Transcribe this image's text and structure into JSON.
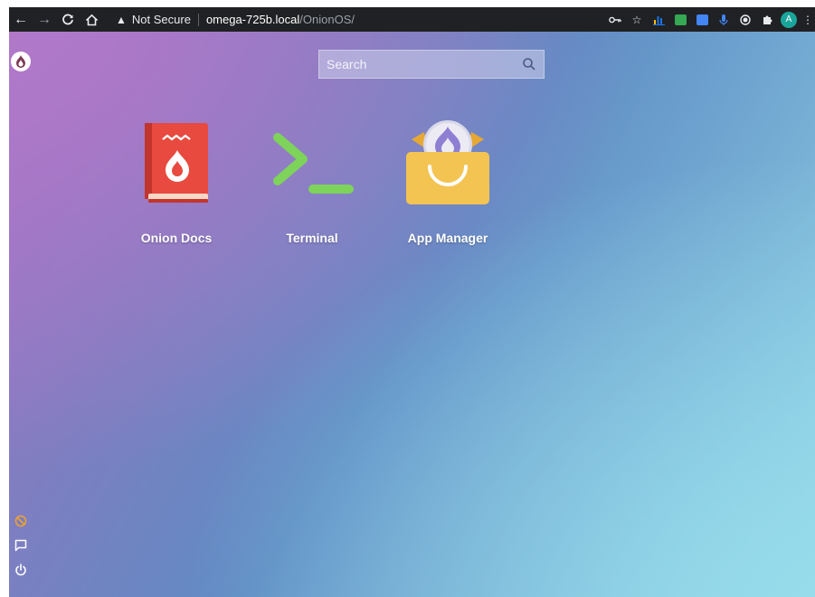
{
  "browser": {
    "security_label": "Not Secure",
    "url_host": "omega-725b.local",
    "url_path": "/OnionOS/",
    "avatar_letter": "A",
    "extensions": [
      {
        "icon": "bar-chart-icon",
        "color": "#1a73e8"
      },
      {
        "icon": "green-box-icon",
        "color": "#34a853"
      },
      {
        "icon": "translate-icon",
        "color": "#4285f4"
      },
      {
        "icon": "microphone-icon",
        "color": "#4285f4"
      },
      {
        "icon": "record-icon",
        "color": "#e8eaed"
      },
      {
        "icon": "puzzle-icon",
        "color": "#e8eaed"
      }
    ]
  },
  "desktop": {
    "search": {
      "placeholder": "Search"
    },
    "apps": [
      {
        "label": "Onion Docs",
        "icon": "book-icon"
      },
      {
        "label": "Terminal",
        "icon": "terminal-icon"
      },
      {
        "label": "App Manager",
        "icon": "shopping-bag-icon"
      }
    ],
    "sidebar_icons": [
      "blocked-icon",
      "chat-icon",
      "power-icon"
    ],
    "colors": {
      "book_red": "#e84a3f",
      "terminal_green": "#7ed35a",
      "bag_yellow": "#f3c452",
      "blocked_orange": "#f0a22e"
    }
  }
}
